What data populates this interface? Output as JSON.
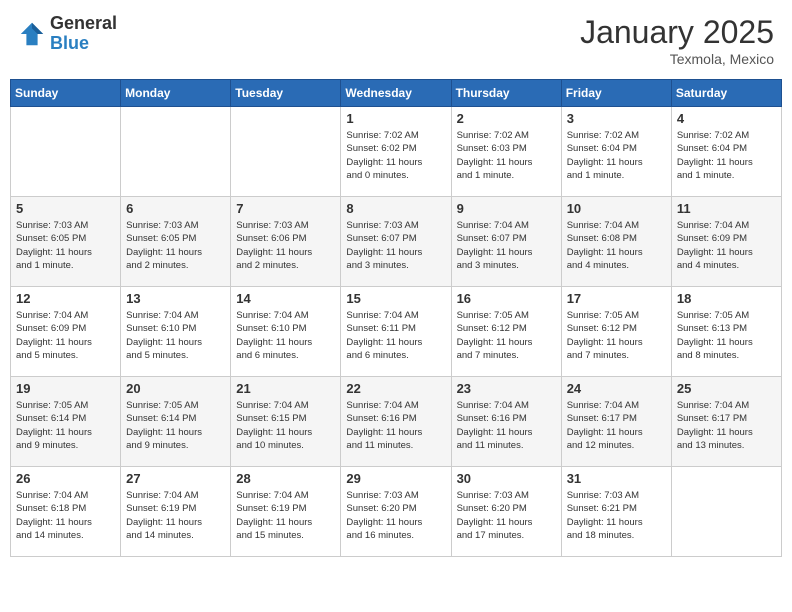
{
  "header": {
    "logo_general": "General",
    "logo_blue": "Blue",
    "month_title": "January 2025",
    "location": "Texmola, Mexico"
  },
  "calendar": {
    "days_of_week": [
      "Sunday",
      "Monday",
      "Tuesday",
      "Wednesday",
      "Thursday",
      "Friday",
      "Saturday"
    ],
    "weeks": [
      [
        {
          "day": "",
          "info": ""
        },
        {
          "day": "",
          "info": ""
        },
        {
          "day": "",
          "info": ""
        },
        {
          "day": "1",
          "info": "Sunrise: 7:02 AM\nSunset: 6:02 PM\nDaylight: 11 hours\nand 0 minutes."
        },
        {
          "day": "2",
          "info": "Sunrise: 7:02 AM\nSunset: 6:03 PM\nDaylight: 11 hours\nand 1 minute."
        },
        {
          "day": "3",
          "info": "Sunrise: 7:02 AM\nSunset: 6:04 PM\nDaylight: 11 hours\nand 1 minute."
        },
        {
          "day": "4",
          "info": "Sunrise: 7:02 AM\nSunset: 6:04 PM\nDaylight: 11 hours\nand 1 minute."
        }
      ],
      [
        {
          "day": "5",
          "info": "Sunrise: 7:03 AM\nSunset: 6:05 PM\nDaylight: 11 hours\nand 1 minute."
        },
        {
          "day": "6",
          "info": "Sunrise: 7:03 AM\nSunset: 6:05 PM\nDaylight: 11 hours\nand 2 minutes."
        },
        {
          "day": "7",
          "info": "Sunrise: 7:03 AM\nSunset: 6:06 PM\nDaylight: 11 hours\nand 2 minutes."
        },
        {
          "day": "8",
          "info": "Sunrise: 7:03 AM\nSunset: 6:07 PM\nDaylight: 11 hours\nand 3 minutes."
        },
        {
          "day": "9",
          "info": "Sunrise: 7:04 AM\nSunset: 6:07 PM\nDaylight: 11 hours\nand 3 minutes."
        },
        {
          "day": "10",
          "info": "Sunrise: 7:04 AM\nSunset: 6:08 PM\nDaylight: 11 hours\nand 4 minutes."
        },
        {
          "day": "11",
          "info": "Sunrise: 7:04 AM\nSunset: 6:09 PM\nDaylight: 11 hours\nand 4 minutes."
        }
      ],
      [
        {
          "day": "12",
          "info": "Sunrise: 7:04 AM\nSunset: 6:09 PM\nDaylight: 11 hours\nand 5 minutes."
        },
        {
          "day": "13",
          "info": "Sunrise: 7:04 AM\nSunset: 6:10 PM\nDaylight: 11 hours\nand 5 minutes."
        },
        {
          "day": "14",
          "info": "Sunrise: 7:04 AM\nSunset: 6:10 PM\nDaylight: 11 hours\nand 6 minutes."
        },
        {
          "day": "15",
          "info": "Sunrise: 7:04 AM\nSunset: 6:11 PM\nDaylight: 11 hours\nand 6 minutes."
        },
        {
          "day": "16",
          "info": "Sunrise: 7:05 AM\nSunset: 6:12 PM\nDaylight: 11 hours\nand 7 minutes."
        },
        {
          "day": "17",
          "info": "Sunrise: 7:05 AM\nSunset: 6:12 PM\nDaylight: 11 hours\nand 7 minutes."
        },
        {
          "day": "18",
          "info": "Sunrise: 7:05 AM\nSunset: 6:13 PM\nDaylight: 11 hours\nand 8 minutes."
        }
      ],
      [
        {
          "day": "19",
          "info": "Sunrise: 7:05 AM\nSunset: 6:14 PM\nDaylight: 11 hours\nand 9 minutes."
        },
        {
          "day": "20",
          "info": "Sunrise: 7:05 AM\nSunset: 6:14 PM\nDaylight: 11 hours\nand 9 minutes."
        },
        {
          "day": "21",
          "info": "Sunrise: 7:04 AM\nSunset: 6:15 PM\nDaylight: 11 hours\nand 10 minutes."
        },
        {
          "day": "22",
          "info": "Sunrise: 7:04 AM\nSunset: 6:16 PM\nDaylight: 11 hours\nand 11 minutes."
        },
        {
          "day": "23",
          "info": "Sunrise: 7:04 AM\nSunset: 6:16 PM\nDaylight: 11 hours\nand 11 minutes."
        },
        {
          "day": "24",
          "info": "Sunrise: 7:04 AM\nSunset: 6:17 PM\nDaylight: 11 hours\nand 12 minutes."
        },
        {
          "day": "25",
          "info": "Sunrise: 7:04 AM\nSunset: 6:17 PM\nDaylight: 11 hours\nand 13 minutes."
        }
      ],
      [
        {
          "day": "26",
          "info": "Sunrise: 7:04 AM\nSunset: 6:18 PM\nDaylight: 11 hours\nand 14 minutes."
        },
        {
          "day": "27",
          "info": "Sunrise: 7:04 AM\nSunset: 6:19 PM\nDaylight: 11 hours\nand 14 minutes."
        },
        {
          "day": "28",
          "info": "Sunrise: 7:04 AM\nSunset: 6:19 PM\nDaylight: 11 hours\nand 15 minutes."
        },
        {
          "day": "29",
          "info": "Sunrise: 7:03 AM\nSunset: 6:20 PM\nDaylight: 11 hours\nand 16 minutes."
        },
        {
          "day": "30",
          "info": "Sunrise: 7:03 AM\nSunset: 6:20 PM\nDaylight: 11 hours\nand 17 minutes."
        },
        {
          "day": "31",
          "info": "Sunrise: 7:03 AM\nSunset: 6:21 PM\nDaylight: 11 hours\nand 18 minutes."
        },
        {
          "day": "",
          "info": ""
        }
      ]
    ]
  }
}
